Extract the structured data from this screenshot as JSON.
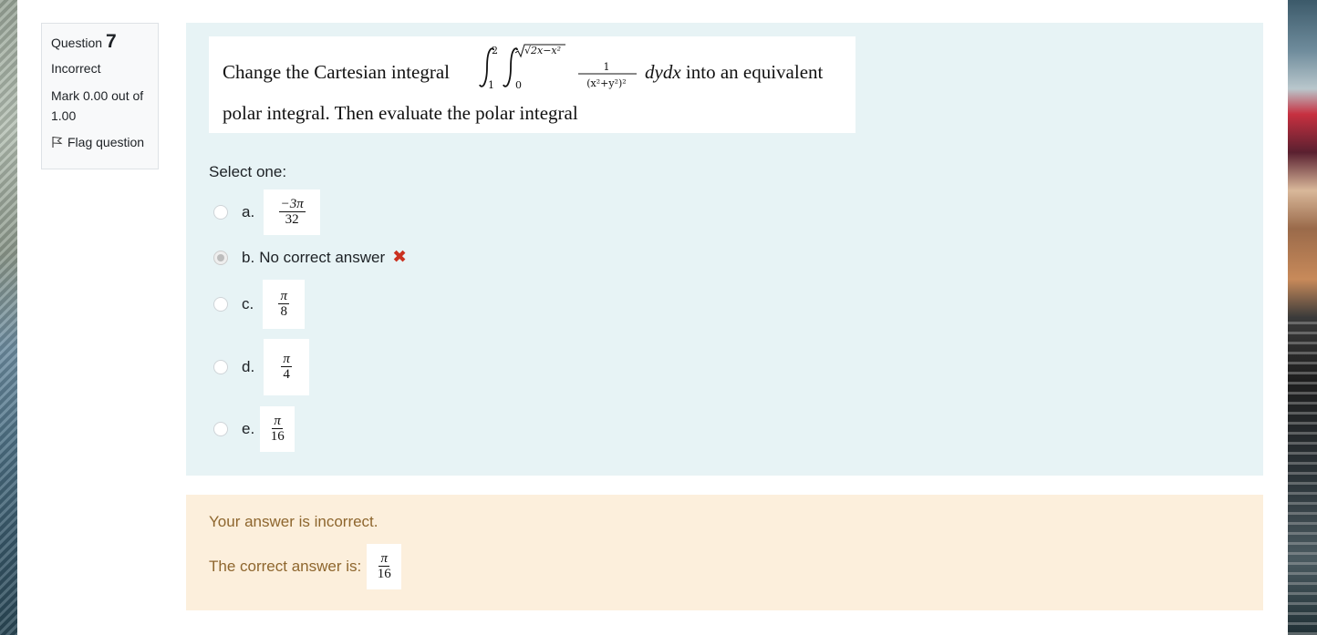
{
  "question": {
    "label": "Question",
    "number": "7",
    "state": "Incorrect",
    "grade": "Mark 0.00 out of 1.00",
    "flag_label": "Flag question"
  },
  "formulation": {
    "text_line1": "Change the Cartesian integral",
    "integral_upper_outer": "2",
    "integral_lower_outer": "1",
    "integral_upper_inner": "√2x−x²",
    "integral_lower_inner": "0",
    "integrand_numerator": "1",
    "integrand_denominator": "(x²+y²)²",
    "differentials": "dydx",
    "text_line1_end": "into an equivalent",
    "text_line2": "polar integral. Then evaluate  the polar integral",
    "prompt": "Select one:"
  },
  "options": [
    {
      "letter": "a.",
      "numerator": "−3π",
      "denominator": "32",
      "selected": false
    },
    {
      "letter": "b.",
      "text": "No correct answer",
      "selected": true,
      "incorrect_icon": "✖"
    },
    {
      "letter": "c.",
      "numerator": "π",
      "denominator": "8",
      "selected": false
    },
    {
      "letter": "d.",
      "numerator": "π",
      "denominator": "4",
      "selected": false
    },
    {
      "letter": "e.",
      "numerator": "π",
      "denominator": "16",
      "selected": false
    }
  ],
  "feedback": {
    "status": "Your answer is incorrect.",
    "correct_label": "The correct answer is:",
    "correct_numerator": "π",
    "correct_denominator": "16"
  },
  "colors": {
    "formulation_bg": "#e7f3f5",
    "feedback_bg": "#fcefdc",
    "feedback_text": "#8e662e",
    "incorrect_icon": "#ca3120"
  }
}
